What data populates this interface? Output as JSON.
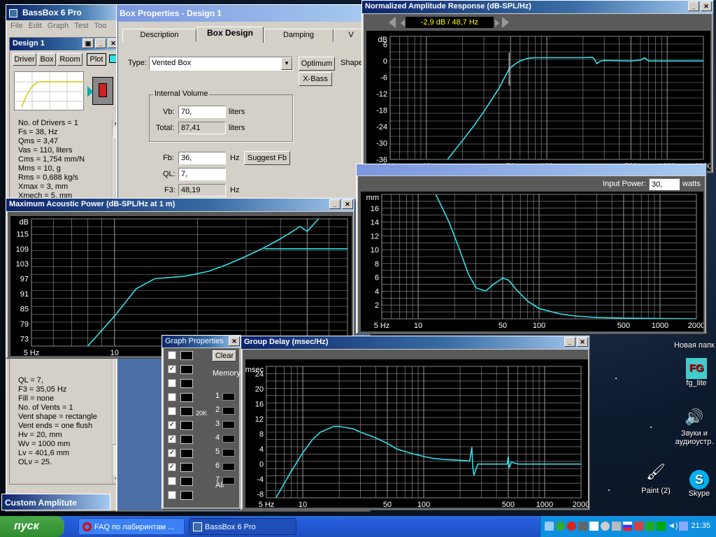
{
  "bassbox": {
    "title": "BassBox 6 Pro",
    "menu": [
      "File",
      "Edit",
      "Graph",
      "Test",
      "Too"
    ],
    "design_panel_title": "Design 1",
    "tabs": [
      "Driver",
      "Box",
      "Room",
      "Plot"
    ],
    "driver_params": [
      "No. of Drivers = 1",
      "Fs = 38, Hz",
      "Qms = 3,47",
      "Vas = 110, liters",
      "Cms = 1,754 mm/N",
      "Mms = 10, g",
      "Rms = 0,688 kg/s",
      "Xmax = 3, mm",
      "Xmech = 5, mm"
    ],
    "box_params": [
      "QL = 7,",
      "F3 = 35,05 Hz",
      "Fill = none",
      "No. of Vents = 1",
      "Vent shape = rectangle",
      "Vent ends = one flush",
      "Hv = 20, mm",
      "Wv = 1000 mm",
      "Lv = 401,6 mm",
      "QLv = 25,"
    ]
  },
  "box_properties": {
    "title": "Box Properties - Design 1",
    "tabs": [
      "Description",
      "Box Design",
      "Damping",
      "V"
    ],
    "type_label": "Type:",
    "type_value": "Vented Box",
    "optimum_button": "Optimum",
    "xbass_button": "X-Bass",
    "shape_label": "Shape",
    "internal_volume_label": "Internal Volume",
    "vb_label": "Vb:",
    "vb_value": "70,",
    "vb_unit": "liters",
    "total_label": "Total:",
    "total_value": "87,41",
    "total_unit": "liters",
    "fb_label": "Fb:",
    "fb_value": "36,",
    "fb_unit": "Hz",
    "suggest_fb_button": "Suggest Fb",
    "ql_label": "QL:",
    "ql_value": "7,",
    "f3_label": "F3:",
    "f3_value": "48,19",
    "f3_unit": "Hz"
  },
  "nar": {
    "title": "Normalized Amplitude Response (dB-SPL/Hz)",
    "readout": "-2,9 dB / 48,7 Hz",
    "y_unit": "dB",
    "y_ticks": [
      "6",
      "0",
      "-6",
      "-12",
      "-18",
      "-24",
      "-30",
      "-36"
    ],
    "y_tick_values": [
      6,
      0,
      -6,
      -12,
      -18,
      -24,
      -30,
      -36
    ],
    "x_ticks": [
      "5 Hz",
      "10",
      "50",
      "100",
      "500",
      "1000",
      "2000"
    ]
  },
  "excursion": {
    "input_power_label": "Input Power:",
    "input_power_value": "30,",
    "input_power_unit": "watts",
    "y_unit": "mm",
    "y_ticks": [
      "16",
      "14",
      "12",
      "10",
      "8",
      "6",
      "4",
      "2"
    ],
    "y_tick_values": [
      16,
      14,
      12,
      10,
      8,
      6,
      4,
      2
    ],
    "x_ticks": [
      "5 Hz",
      "10",
      "50",
      "100",
      "500",
      "1000",
      "2000"
    ]
  },
  "map": {
    "title": "Maximum Acoustic Power (dB-SPL/Hz at 1 m)",
    "y_unit": "dB",
    "y_ticks": [
      "115",
      "109",
      "103",
      "97",
      "91",
      "85",
      "79",
      "73"
    ],
    "y_tick_values": [
      115,
      109,
      103,
      97,
      91,
      85,
      79,
      73
    ],
    "x_ticks": [
      "5 Hz",
      "10",
      "50"
    ]
  },
  "graph_props": {
    "title": "Graph Properties",
    "clear_button": "Clear",
    "memory_label": "Memory",
    "memory_slots": [
      "1",
      "2",
      "3",
      "4",
      "5",
      "6",
      "7"
    ],
    "all_label": "All",
    "range_label": "20K"
  },
  "group_delay": {
    "title": "Group Delay (msec/Hz)",
    "y_unit": "msec",
    "y_ticks": [
      "24",
      "20",
      "16",
      "12",
      "8",
      "4",
      "0",
      "-4",
      "-8"
    ],
    "y_tick_values": [
      24,
      20,
      16,
      12,
      8,
      4,
      0,
      -4,
      -8
    ],
    "x_ticks": [
      "5 Hz",
      "10",
      "50",
      "100",
      "500",
      "1000",
      "2000"
    ]
  },
  "custom_amp": {
    "title": "Custom Amplitute"
  },
  "desktop_icons": {
    "new_folder": "Новая папк",
    "fg_lite": "fg_lite",
    "fg_badge": "FG",
    "sounds": "Звуки и аудиоустр.",
    "paint": "Paint (2)",
    "skype": "Skype"
  },
  "taskbar": {
    "start": "пуск",
    "tasks": [
      "FAQ по лабиринтам ...",
      "BassBox 6 Pro"
    ],
    "clock": "21:35"
  },
  "colors": {
    "curve": "#33e0e6",
    "grid": "#8a8a8a",
    "plot_bg": "#000000",
    "titlebar": "#0a246a"
  },
  "chart_data": [
    {
      "type": "line",
      "title": "Normalized Amplitude Response (dB-SPL/Hz)",
      "xlabel": "Hz",
      "ylabel": "dB",
      "x_scale": "log",
      "xlim": [
        5,
        2000
      ],
      "ylim": [
        -36,
        9
      ],
      "series": [
        {
          "x": [
            15,
            20,
            25,
            30,
            35,
            40,
            48.7,
            55,
            60,
            70,
            80,
            100,
            150,
            200,
            240,
            250,
            260,
            280,
            300,
            500,
            600,
            650,
            700,
            1000,
            2000
          ],
          "values": [
            -36,
            -29,
            -23.5,
            -18.5,
            -14,
            -10,
            -2.9,
            -1,
            0,
            1,
            1.2,
            1.2,
            1.2,
            1.2,
            1.3,
            0.5,
            -1,
            0,
            0.2,
            0,
            0.3,
            1.2,
            0,
            0,
            0
          ]
        }
      ]
    },
    {
      "type": "line",
      "title": "",
      "xlabel": "Hz",
      "ylabel": "mm",
      "x_scale": "log",
      "xlim": [
        5,
        2000
      ],
      "ylim": [
        0,
        18
      ],
      "series": [
        {
          "x": [
            14,
            18,
            22,
            26,
            30,
            36,
            42,
            50,
            56,
            65,
            80,
            100,
            150,
            200,
            300,
            500,
            1000,
            2000
          ],
          "values": [
            18,
            14,
            10,
            6.5,
            4.5,
            4,
            5,
            5.9,
            5.6,
            4.2,
            2.6,
            1.5,
            0.7,
            0.4,
            0.2,
            0.1,
            0.05,
            0
          ]
        }
      ]
    },
    {
      "type": "line",
      "title": "Maximum Acoustic Power (dB-SPL/Hz at 1 m)",
      "xlabel": "Hz",
      "ylabel": "dB",
      "x_scale": "log",
      "xlim": [
        5,
        70
      ],
      "ylim": [
        70,
        121
      ],
      "series": [
        {
          "name": "",
          "x": [
            8,
            10,
            12,
            14,
            18,
            22,
            26,
            30,
            35,
            40,
            45,
            47,
            50,
            55
          ],
          "values": [
            70,
            82,
            93,
            97,
            98,
            100,
            103,
            106,
            109.5,
            113,
            116.5,
            118,
            116,
            121
          ]
        },
        {
          "name": "",
          "x": [
            35,
            40,
            50,
            70
          ],
          "values": [
            109,
            109,
            109,
            109
          ]
        }
      ]
    },
    {
      "type": "line",
      "title": "Group Delay (msec/Hz)",
      "xlabel": "Hz",
      "ylabel": "msec",
      "x_scale": "log",
      "xlim": [
        5,
        2000
      ],
      "ylim": [
        -9,
        26
      ],
      "series": [
        {
          "x": [
            6,
            8,
            10,
            12,
            14,
            18,
            20,
            22,
            26,
            30,
            40,
            50,
            60,
            80,
            100,
            120,
            150,
            200,
            240,
            250,
            255,
            260,
            280,
            400,
            490,
            500,
            510,
            530,
            600,
            700,
            800,
            1000,
            2000
          ],
          "values": [
            -9,
            -2,
            3,
            6.5,
            8.5,
            10,
            10,
            9.8,
            9.4,
            8.5,
            7,
            5.5,
            4,
            2.8,
            2,
            1.5,
            1.2,
            1,
            0.8,
            4.5,
            -1,
            -3,
            0,
            0,
            0,
            2,
            -1,
            0.5,
            0,
            0,
            0,
            0,
            0
          ]
        }
      ]
    }
  ]
}
